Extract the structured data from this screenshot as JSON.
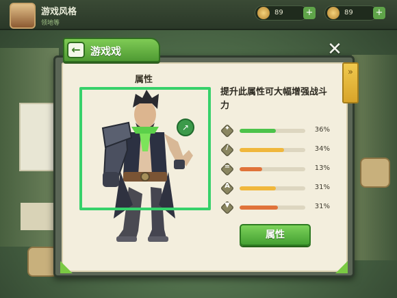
{
  "background": {
    "player_name": "游戏风格",
    "player_sub": "领地等",
    "resource1": "89",
    "resource2": "89"
  },
  "dialog": {
    "title": "游戏戏",
    "back_icon": "arrow-left-icon",
    "close_icon": "close-icon",
    "attribute_heading": "属性",
    "description": "提升此属性可大幅增强战斗力",
    "stats": [
      {
        "icon": "leaf-icon",
        "glyph": "✦",
        "value_label": "36%",
        "fill": 0.55,
        "color": "#4cc34a"
      },
      {
        "icon": "sword-icon",
        "glyph": "/",
        "value_label": "34%",
        "fill": 0.68,
        "color": "#f0b73c"
      },
      {
        "icon": "equals-icon",
        "glyph": "=",
        "value_label": "13%",
        "fill": 0.34,
        "color": "#e0733a"
      },
      {
        "icon": "hat-icon",
        "glyph": "A",
        "value_label": "31%",
        "fill": 0.55,
        "color": "#f0b73c"
      },
      {
        "icon": "drop-icon",
        "glyph": "▼",
        "value_label": "31%",
        "fill": 0.58,
        "color": "#e0733a"
      }
    ],
    "button_label": "属性"
  },
  "colors": {
    "highlight": "#36d16a",
    "accent_green": "#5fb03d",
    "paper": "#f3eedd"
  }
}
